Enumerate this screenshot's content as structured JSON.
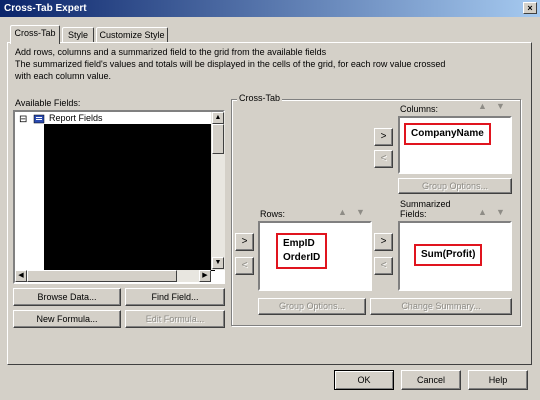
{
  "window": {
    "title": "Cross-Tab Expert",
    "close_glyph": "×"
  },
  "tabs": [
    {
      "label": "Cross-Tab",
      "active": true
    },
    {
      "label": "Style",
      "active": false
    },
    {
      "label": "Customize Style",
      "active": false
    }
  ],
  "description": [
    "Add rows, columns and a summarized field to the grid from the available fields",
    "The summarized field's values and totals will be displayed in the cells of the grid, for each row value crossed",
    "with each column value."
  ],
  "available_fields": {
    "label": "Available Fields:",
    "tree_root": {
      "expander": "⊟",
      "label": "Report Fields"
    }
  },
  "left_buttons": {
    "browse_data": "Browse Data...",
    "find_field": "Find Field...",
    "new_formula": "New Formula...",
    "edit_formula": "Edit Formula..."
  },
  "crosstab": {
    "group_title": "Cross-Tab",
    "columns": {
      "label": "Columns:",
      "value": "CompanyName"
    },
    "rows": {
      "label": "Rows:",
      "values": [
        "EmpID",
        "OrderID"
      ]
    },
    "summarized": {
      "label_line1": "Summarized",
      "label_line2": "Fields:",
      "value": "Sum(Profit)"
    },
    "add_glyph": ">",
    "remove_glyph": "<",
    "up_glyph": "▲",
    "down_glyph": "▼",
    "group_options_label": "Group Options...",
    "change_summary_label": "Change Summary..."
  },
  "footer": {
    "ok": "OK",
    "cancel": "Cancel",
    "help": "Help"
  }
}
